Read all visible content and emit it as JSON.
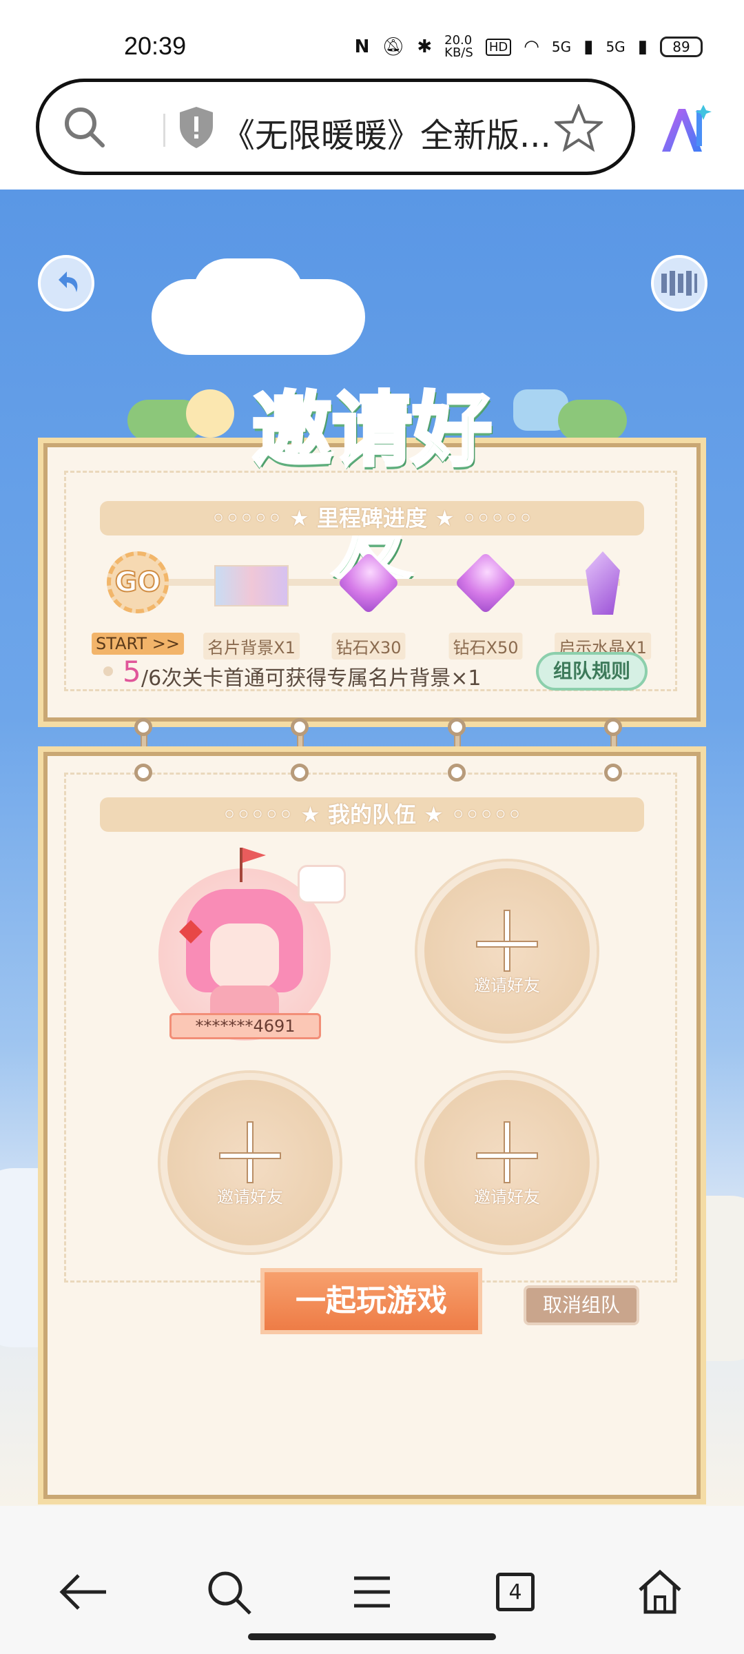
{
  "status_bar": {
    "time": "20:39",
    "net_speed": "20.0\nKB/S",
    "hd": "HD",
    "signal1": "5G",
    "signal2": "5G",
    "battery": "89"
  },
  "browser": {
    "title": "《无限暖暖》全新版..."
  },
  "game": {
    "heading": "邀请好友",
    "milestone_section": "里程碑进度",
    "milestones": [
      {
        "label": "START >>"
      },
      {
        "label": "名片背景X1"
      },
      {
        "label": "钻石X30"
      },
      {
        "label": "钻石X50"
      },
      {
        "label": "启示水晶X1"
      }
    ],
    "go_text": "GO",
    "progress_current": "5",
    "progress_rest": "/6次关卡首通可获得专属名片背景×1",
    "rules_button": "组队规则",
    "team_section": "我的队伍",
    "player_id": "*******4691",
    "invite_label": "邀请好友",
    "play_button": "一起玩游戏",
    "cancel_button": "取消组队"
  },
  "colors": {
    "sky": "#5a97e5",
    "heading_green": "#7fcf9b",
    "accent_orange": "#ef7f49",
    "progress_pink": "#e0569a"
  }
}
